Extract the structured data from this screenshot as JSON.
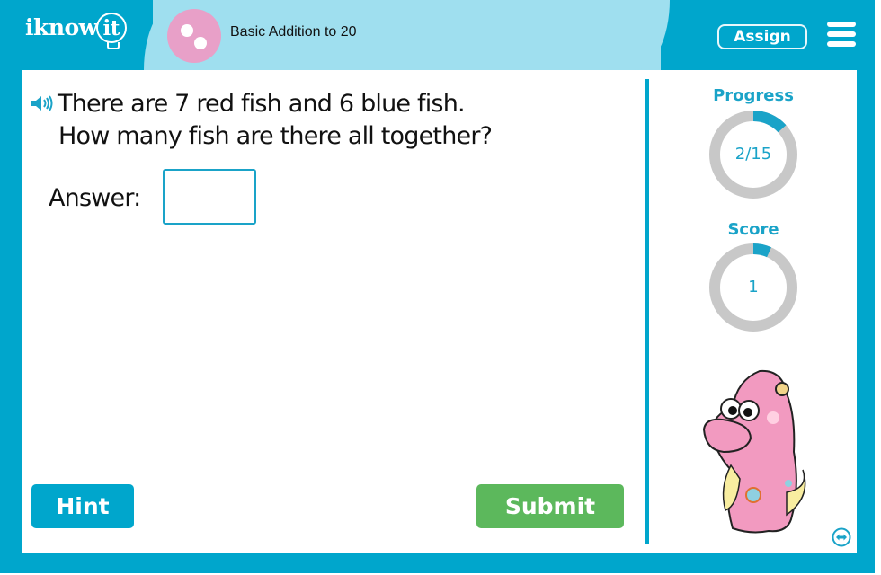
{
  "header": {
    "logo_text": "iknow",
    "logo_bulb_text": "it",
    "topic_title": "Basic Addition to 20",
    "assign_label": "Assign",
    "menu_icon": "hamburger-menu-icon"
  },
  "question": {
    "audio_icon": "speaker-icon",
    "line1": "There are 7 red fish and 6 blue fish.",
    "line2": "How many fish are there all together?"
  },
  "answer": {
    "label": "Answer:",
    "value": "",
    "placeholder": ""
  },
  "buttons": {
    "hint_label": "Hint",
    "submit_label": "Submit"
  },
  "sidebar": {
    "progress": {
      "label": "Progress",
      "text": "2/15",
      "current": 2,
      "total": 15
    },
    "score": {
      "label": "Score",
      "text": "1",
      "fraction": 0.0667
    },
    "mascot": "pink-monster-mascot",
    "resize_icon": "resize-horizontal-icon"
  },
  "colors": {
    "brand_blue": "#00a6cc",
    "header_light_blue": "#9fdfef",
    "topic_pink": "#e8a0c8",
    "submit_green": "#5cb85c",
    "ring_gray": "#c8c8c8",
    "ring_fill": "#1aa3c8"
  }
}
